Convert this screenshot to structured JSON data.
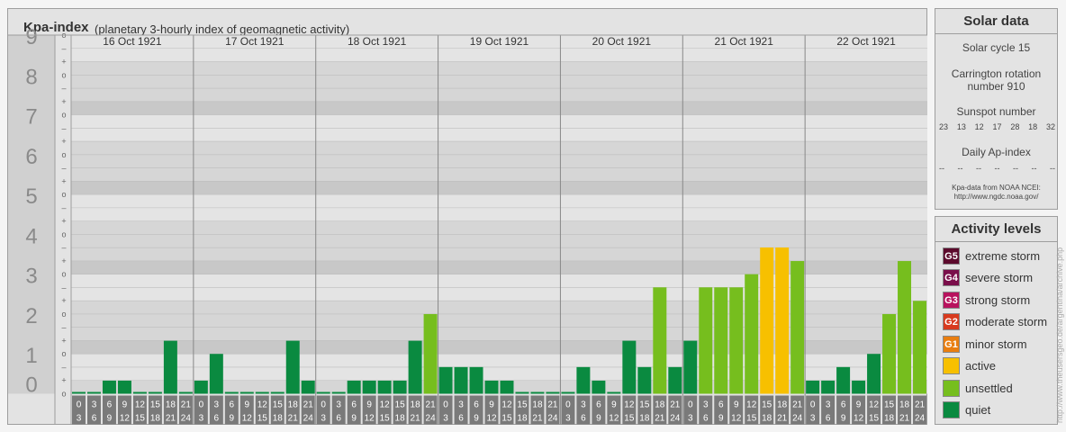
{
  "header": {
    "title": "Kpa-index",
    "subtitle": "(planetary 3-hourly index of geomagnetic activity)"
  },
  "chart_data": {
    "type": "bar",
    "title": "Kpa-index",
    "ylim": [
      0,
      9
    ],
    "y_ticks": [
      "0",
      "1",
      "2",
      "3",
      "4",
      "5",
      "6",
      "7",
      "8",
      "9"
    ],
    "sub_ticks": [
      "–",
      "o",
      "+"
    ],
    "days": [
      "16 Oct 1921",
      "17 Oct 1921",
      "18 Oct 1921",
      "19 Oct 1921",
      "20 Oct 1921",
      "21 Oct 1921",
      "22 Oct 1921"
    ],
    "interval_start_labels": [
      "0",
      "3",
      "6",
      "9",
      "12",
      "15",
      "18",
      "21"
    ],
    "interval_end_labels": [
      "3",
      "6",
      "9",
      "12",
      "15",
      "18",
      "21",
      "24"
    ],
    "values": [
      [
        0,
        0,
        0.33,
        0.33,
        0,
        0,
        1.33,
        0
      ],
      [
        0.33,
        1,
        0,
        0,
        0,
        0,
        1.33,
        0.33
      ],
      [
        0,
        0,
        0.33,
        0.33,
        0.33,
        0.33,
        1.33,
        2
      ],
      [
        0.67,
        0.67,
        0.67,
        0.33,
        0.33,
        0,
        0,
        0
      ],
      [
        0,
        0.67,
        0.33,
        0,
        1.33,
        0.67,
        2.67,
        0.67
      ],
      [
        1.33,
        2.67,
        2.67,
        2.67,
        3,
        3.67,
        3.67,
        3.33
      ],
      [
        0.33,
        0.33,
        0.67,
        0.33,
        1,
        2,
        3.33,
        2.33
      ]
    ],
    "colors": {
      "quiet": "#0a8a40",
      "unsettled": "#76be1e",
      "active": "#f7c000"
    }
  },
  "solar": {
    "title": "Solar data",
    "cycle": "Solar cycle 15",
    "carrington_line1": "Carrington rotation",
    "carrington_line2": "number 910",
    "sunspot_title": "Sunspot number",
    "sunspots": [
      "23",
      "13",
      "12",
      "17",
      "28",
      "18",
      "32"
    ],
    "ap_title": "Daily Ap-index",
    "ap_values": [
      "--",
      "--",
      "--",
      "--",
      "--",
      "--",
      "--"
    ],
    "source_line1": "Kpa-data from NOAA NCEI:",
    "source_line2": "http://www.ngdc.noaa.gov/"
  },
  "activity": {
    "title": "Activity levels",
    "levels": [
      {
        "badge": "G5",
        "label": "extreme storm",
        "color": "#5c0a2c"
      },
      {
        "badge": "G4",
        "label": "severe storm",
        "color": "#7a0e4a"
      },
      {
        "badge": "G3",
        "label": "strong storm",
        "color": "#b8125e"
      },
      {
        "badge": "G2",
        "label": "moderate storm",
        "color": "#d83a1e"
      },
      {
        "badge": "G1",
        "label": "minor storm",
        "color": "#e97e10"
      },
      {
        "badge": "",
        "label": "active",
        "color": "#f7c000"
      },
      {
        "badge": "",
        "label": "unsettled",
        "color": "#76be1e"
      },
      {
        "badge": "",
        "label": "quiet",
        "color": "#0a8a40"
      }
    ]
  },
  "credit": "http://www.theusersgeo.de/argentina/archive.php"
}
